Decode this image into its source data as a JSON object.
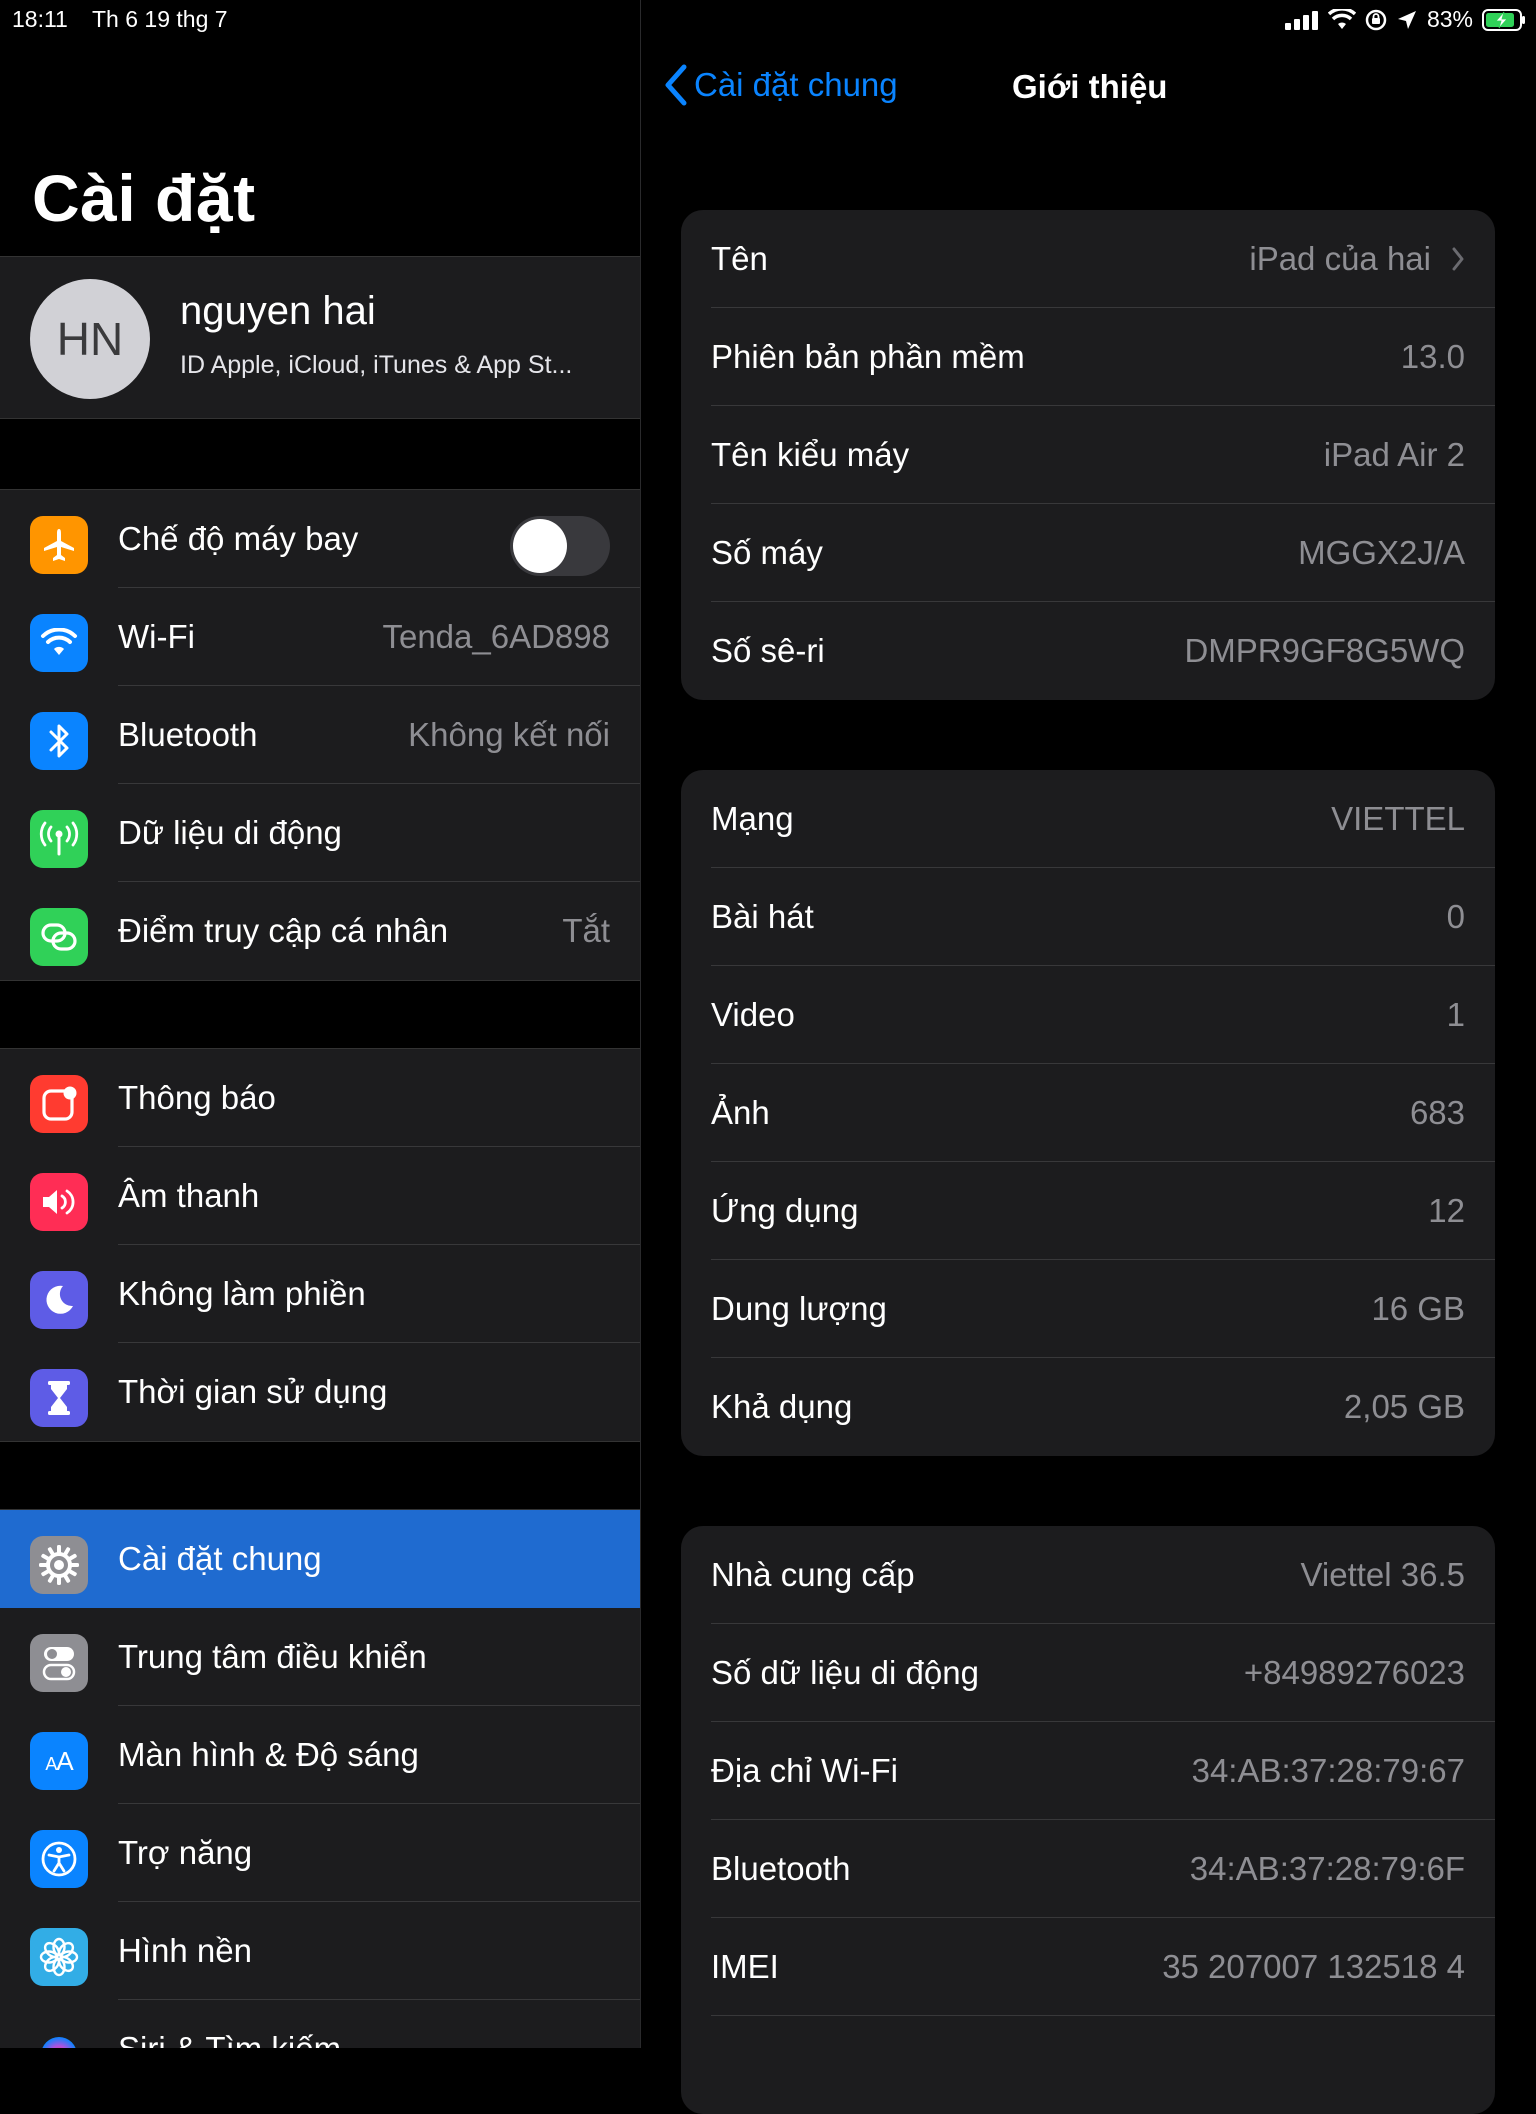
{
  "status_bar": {
    "time": "18:11",
    "date": "Th 6 19 thg 7",
    "battery": "83%"
  },
  "sidebar": {
    "title": "Cài đặt",
    "profile": {
      "initials": "HN",
      "name": "nguyen hai",
      "subtitle": "ID Apple, iCloud, iTunes & App St..."
    },
    "groups": [
      [
        {
          "label": "Chế độ máy bay",
          "value": "",
          "icon": "airplane-icon",
          "color": "#ff9500",
          "toggle": true
        },
        {
          "label": "Wi-Fi",
          "value": "Tenda_6AD898",
          "icon": "wifi-icon",
          "color": "#0a84ff"
        },
        {
          "label": "Bluetooth",
          "value": "Không kết nối",
          "icon": "bluetooth-icon",
          "color": "#0a84ff"
        },
        {
          "label": "Dữ liệu di động",
          "value": "",
          "icon": "cellular-antenna-icon",
          "color": "#30d158"
        },
        {
          "label": "Điểm truy cập cá nhân",
          "value": "Tắt",
          "icon": "hotspot-link-icon",
          "color": "#30d158"
        }
      ],
      [
        {
          "label": "Thông báo",
          "value": "",
          "icon": "notifications-icon",
          "color": "#ff3b30"
        },
        {
          "label": "Âm thanh",
          "value": "",
          "icon": "speaker-icon",
          "color": "#ff2d55"
        },
        {
          "label": "Không làm phiền",
          "value": "",
          "icon": "moon-icon",
          "color": "#5e5ce6"
        },
        {
          "label": "Thời gian sử dụng",
          "value": "",
          "icon": "hourglass-icon",
          "color": "#5e5ce6"
        }
      ],
      [
        {
          "label": "Cài đặt chung",
          "value": "",
          "icon": "gear-icon",
          "color": "#8e8e93",
          "selected": true
        },
        {
          "label": "Trung tâm điều khiển",
          "value": "",
          "icon": "switches-icon",
          "color": "#8e8e93"
        },
        {
          "label": "Màn hình & Độ sáng",
          "value": "",
          "icon": "text-size-icon",
          "color": "#0a84ff",
          "glyph": "AA"
        },
        {
          "label": "Trợ năng",
          "value": "",
          "icon": "accessibility-icon",
          "color": "#0a84ff"
        },
        {
          "label": "Hình nền",
          "value": "",
          "icon": "flower-icon",
          "color": "#32ade6"
        },
        {
          "label": "Siri & Tìm kiếm",
          "value": "",
          "icon": "siri-icon",
          "color": "#1c1c1e"
        }
      ]
    ]
  },
  "detail": {
    "back_label": "Cài đặt chung",
    "title": "Giới thiệu",
    "cards": [
      [
        {
          "label": "Tên",
          "value": "iPad của hai",
          "chevron": true
        },
        {
          "label": "Phiên bản phần mềm",
          "value": "13.0"
        },
        {
          "label": "Tên kiểu máy",
          "value": "iPad Air 2"
        },
        {
          "label": "Số máy",
          "value": "MGGX2J/A"
        },
        {
          "label": "Số sê-ri",
          "value": "DMPR9GF8G5WQ"
        }
      ],
      [
        {
          "label": "Mạng",
          "value": "VIETTEL"
        },
        {
          "label": "Bài hát",
          "value": "0"
        },
        {
          "label": "Video",
          "value": "1"
        },
        {
          "label": "Ảnh",
          "value": "683"
        },
        {
          "label": "Ứng dụng",
          "value": "12"
        },
        {
          "label": "Dung lượng",
          "value": "16 GB"
        },
        {
          "label": "Khả dụng",
          "value": "2,05 GB"
        }
      ],
      [
        {
          "label": "Nhà cung cấp",
          "value": "Viettel 36.5"
        },
        {
          "label": "Số dữ liệu di động",
          "value": "+84989276023"
        },
        {
          "label": "Địa chỉ Wi-Fi",
          "value": "34:AB:37:28:79:67"
        },
        {
          "label": "Bluetooth",
          "value": "34:AB:37:28:79:6F"
        },
        {
          "label": "IMEI",
          "value": "35 207007 132518 4"
        },
        {
          "label": "",
          "value": ""
        }
      ]
    ]
  }
}
